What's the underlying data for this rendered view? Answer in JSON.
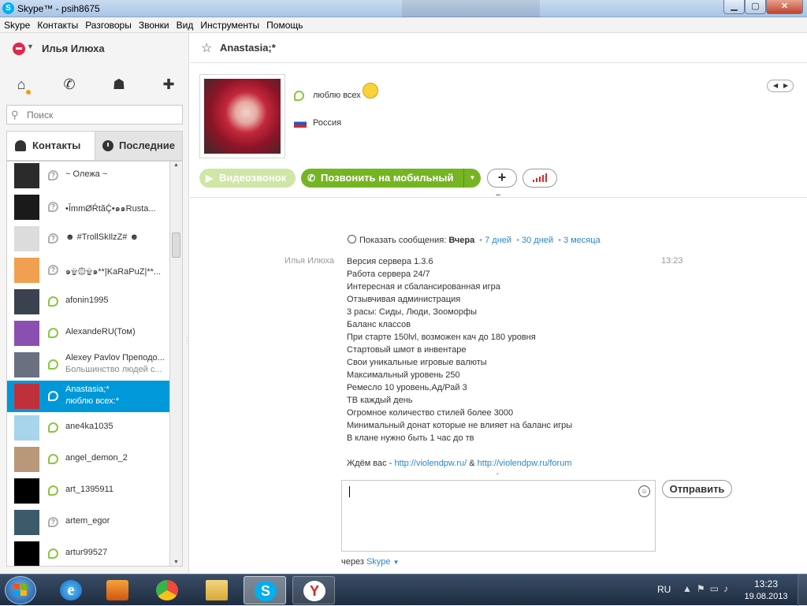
{
  "window": {
    "title": "Skype™ - psih8675",
    "min_label": "▁",
    "max_label": "▢",
    "close_label": "✕"
  },
  "menu": [
    "Skype",
    "Контакты",
    "Разговоры",
    "Звонки",
    "Вид",
    "Инструменты",
    "Помощь"
  ],
  "user": {
    "name": "Илья Илюха"
  },
  "search": {
    "placeholder": "Поиск"
  },
  "tabs": {
    "contacts": "Контакты",
    "recent": "Последние"
  },
  "contacts": [
    {
      "name": "~ Олежа ~",
      "mood": "",
      "status": "unknown",
      "avatar": "#2b2b2b"
    },
    {
      "name": "•ȊmmØŔtãḈ•๑๑Rustа...",
      "mood": "",
      "status": "unknown",
      "avatar": "#1a1a1a"
    },
    {
      "name": "☻ #TrollSkIlzZ# ☻",
      "mood": "",
      "status": "unknown",
      "avatar": "#dcdcdc"
    },
    {
      "name": "๑۩۞۩๑**|KaRaPuZ|**...",
      "mood": "",
      "status": "unknown",
      "avatar": "#f0a050"
    },
    {
      "name": "afonin1995",
      "mood": "",
      "status": "online",
      "avatar": "#3a4250"
    },
    {
      "name": "AlexandeRU(Том)",
      "mood": "",
      "status": "online",
      "avatar": "#8a4fb0"
    },
    {
      "name": "Alexey Pavlov Преподо...",
      "mood": "Большинство людей с...",
      "status": "online",
      "avatar": "#6a7080"
    },
    {
      "name": "Anastasia;*",
      "mood": "люблю всех:*",
      "status": "online",
      "avatar": "#c0303a",
      "selected": true
    },
    {
      "name": "ane4ka1035",
      "mood": "",
      "status": "online",
      "avatar": "#a8d4ec"
    },
    {
      "name": "angel_demon_2",
      "mood": "",
      "status": "online",
      "avatar": "#b89878"
    },
    {
      "name": "art_1395911",
      "mood": "",
      "status": "online",
      "avatar": "#000000"
    },
    {
      "name": "artem_egor",
      "mood": "",
      "status": "unknown",
      "avatar": "#3c5a6a"
    },
    {
      "name": "artur99527",
      "mood": "",
      "status": "online",
      "avatar": "#000000"
    }
  ],
  "chat": {
    "name": "Anastasia;*",
    "mood": "люблю всех",
    "country": "Россия",
    "video_call": "Видеозвонок",
    "call_mobile": "Позвонить на мобильный",
    "history": {
      "prefix": "Показать сообщения:",
      "current": "Вчера",
      "options": [
        "7 дней",
        "30 дней",
        "3 месяца"
      ]
    },
    "sender": "Илья Илюха",
    "time": "13:23",
    "message_lines": [
      "Версия сервера 1.3.6",
      "Работа сервера 24/7",
      "Интересная и сбалансированная игра",
      "Отзывчивая администрация",
      "3 расы: Сиды, Люди, Зооморфы",
      "Баланс классов",
      "При старте 150lvl, возможен кач до 180 уровня",
      "Стартовый шмот в инвентаре",
      "Свои уникальные игровые валюты",
      "Максимальный уровень 250",
      "Ремесло 10 уровень,Ад/Рай 3",
      "ТВ каждый день",
      "Огромное количество стилей более 3000",
      "Минимальный донат которые не влияет на баланс игры",
      "В клане нужно быть 1 час до тв"
    ],
    "closing": {
      "prefix": "Ждём вас -",
      "link1": "http://violendpw.ru/",
      "amp": "&",
      "link2": "http://violendpw.ru/forum"
    },
    "input_value": "",
    "send": "Отправить",
    "via_prefix": "через",
    "via_value": "Skype"
  },
  "taskbar": {
    "apps": [
      "Internet Explorer",
      "Media Player",
      "Browser",
      "Explorer",
      "Skype",
      "Yandex"
    ],
    "lang": "RU",
    "time": "13:23",
    "date": "19.08.2013"
  }
}
